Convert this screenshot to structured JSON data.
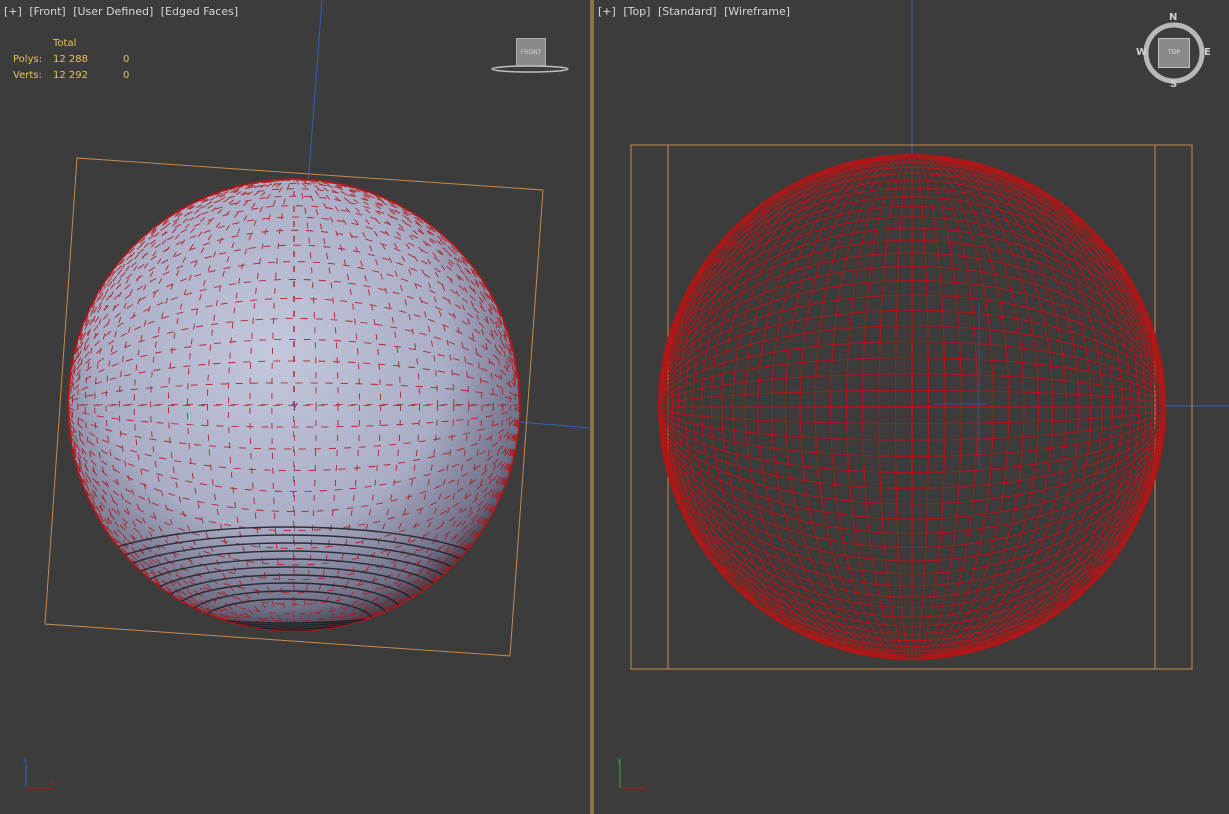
{
  "left_viewport": {
    "label_parts": [
      "[+]",
      "[Front]",
      "[User Defined]",
      "[Edged Faces]"
    ],
    "stats": {
      "header": "Total",
      "rows": [
        {
          "key": "Polys:",
          "total": "12 288",
          "selected": "0"
        },
        {
          "key": "Verts:",
          "total": "12 292",
          "selected": "0"
        }
      ]
    },
    "viewcube_label": "FRONT"
  },
  "right_viewport": {
    "label_parts": [
      "[+]",
      "[Top]",
      "[Standard]",
      "[Wireframe]"
    ],
    "viewcube_label": "TOP",
    "compass": {
      "n": "N",
      "s": "S",
      "e": "E",
      "w": "W"
    }
  },
  "colors": {
    "background": "#3c3c3c",
    "wire": "#b01818",
    "bbox": "#c88a50",
    "axis": "#2f5fb8",
    "shaded_sphere": "#a8acc4"
  }
}
